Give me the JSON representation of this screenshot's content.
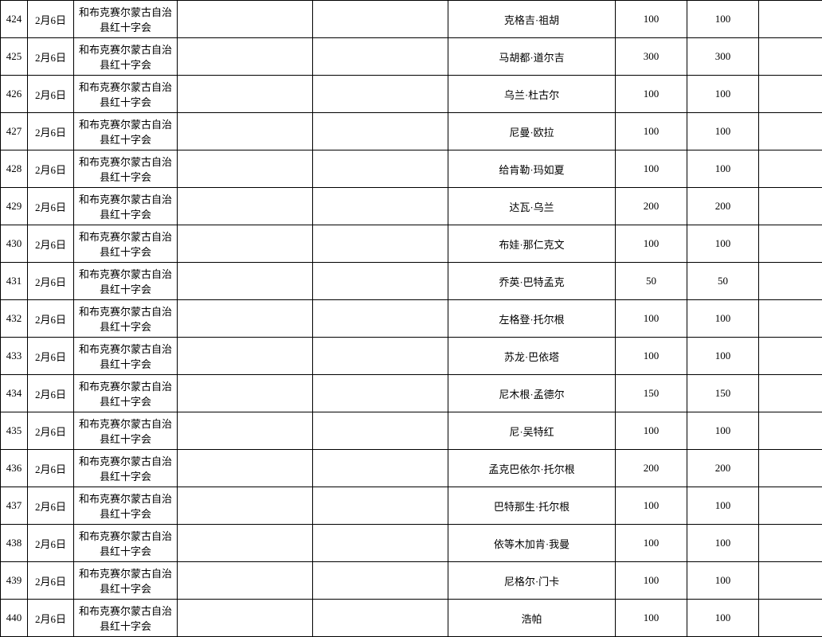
{
  "rows": [
    {
      "idx": "424",
      "date": "2月6日",
      "org": "和布克赛尔蒙古自治县红十字会",
      "name": "克格吉·祖胡",
      "a": "100",
      "b": "100"
    },
    {
      "idx": "425",
      "date": "2月6日",
      "org": "和布克赛尔蒙古自治县红十字会",
      "name": "马胡都·道尔吉",
      "a": "300",
      "b": "300"
    },
    {
      "idx": "426",
      "date": "2月6日",
      "org": "和布克赛尔蒙古自治县红十字会",
      "name": "乌兰·杜古尔",
      "a": "100",
      "b": "100"
    },
    {
      "idx": "427",
      "date": "2月6日",
      "org": "和布克赛尔蒙古自治县红十字会",
      "name": "尼曼·欧拉",
      "a": "100",
      "b": "100"
    },
    {
      "idx": "428",
      "date": "2月6日",
      "org": "和布克赛尔蒙古自治县红十字会",
      "name": "给肯勒·玛如夏",
      "a": "100",
      "b": "100"
    },
    {
      "idx": "429",
      "date": "2月6日",
      "org": "和布克赛尔蒙古自治县红十字会",
      "name": "达瓦·乌兰",
      "a": "200",
      "b": "200"
    },
    {
      "idx": "430",
      "date": "2月6日",
      "org": "和布克赛尔蒙古自治县红十字会",
      "name": "布娃·那仁克文",
      "a": "100",
      "b": "100"
    },
    {
      "idx": "431",
      "date": "2月6日",
      "org": "和布克赛尔蒙古自治县红十字会",
      "name": "乔英·巴特孟克",
      "a": "50",
      "b": "50"
    },
    {
      "idx": "432",
      "date": "2月6日",
      "org": "和布克赛尔蒙古自治县红十字会",
      "name": "左格登·托尔根",
      "a": "100",
      "b": "100"
    },
    {
      "idx": "433",
      "date": "2月6日",
      "org": "和布克赛尔蒙古自治县红十字会",
      "name": "苏龙·巴依塔",
      "a": "100",
      "b": "100"
    },
    {
      "idx": "434",
      "date": "2月6日",
      "org": "和布克赛尔蒙古自治县红十字会",
      "name": "尼木根·孟德尔",
      "a": "150",
      "b": "150"
    },
    {
      "idx": "435",
      "date": "2月6日",
      "org": "和布克赛尔蒙古自治县红十字会",
      "name": "尼·吴特红",
      "a": "100",
      "b": "100"
    },
    {
      "idx": "436",
      "date": "2月6日",
      "org": "和布克赛尔蒙古自治县红十字会",
      "name": "孟克巴依尔·托尔根",
      "a": "200",
      "b": "200"
    },
    {
      "idx": "437",
      "date": "2月6日",
      "org": "和布克赛尔蒙古自治县红十字会",
      "name": "巴特那生·托尔根",
      "a": "100",
      "b": "100"
    },
    {
      "idx": "438",
      "date": "2月6日",
      "org": "和布克赛尔蒙古自治县红十字会",
      "name": "依等木加肯·我曼",
      "a": "100",
      "b": "100"
    },
    {
      "idx": "439",
      "date": "2月6日",
      "org": "和布克赛尔蒙古自治县红十字会",
      "name": "尼格尔·门卡",
      "a": "100",
      "b": "100"
    },
    {
      "idx": "440",
      "date": "2月6日",
      "org": "和布克赛尔蒙古自治县红十字会",
      "name": "浩帕",
      "a": "100",
      "b": "100"
    }
  ]
}
